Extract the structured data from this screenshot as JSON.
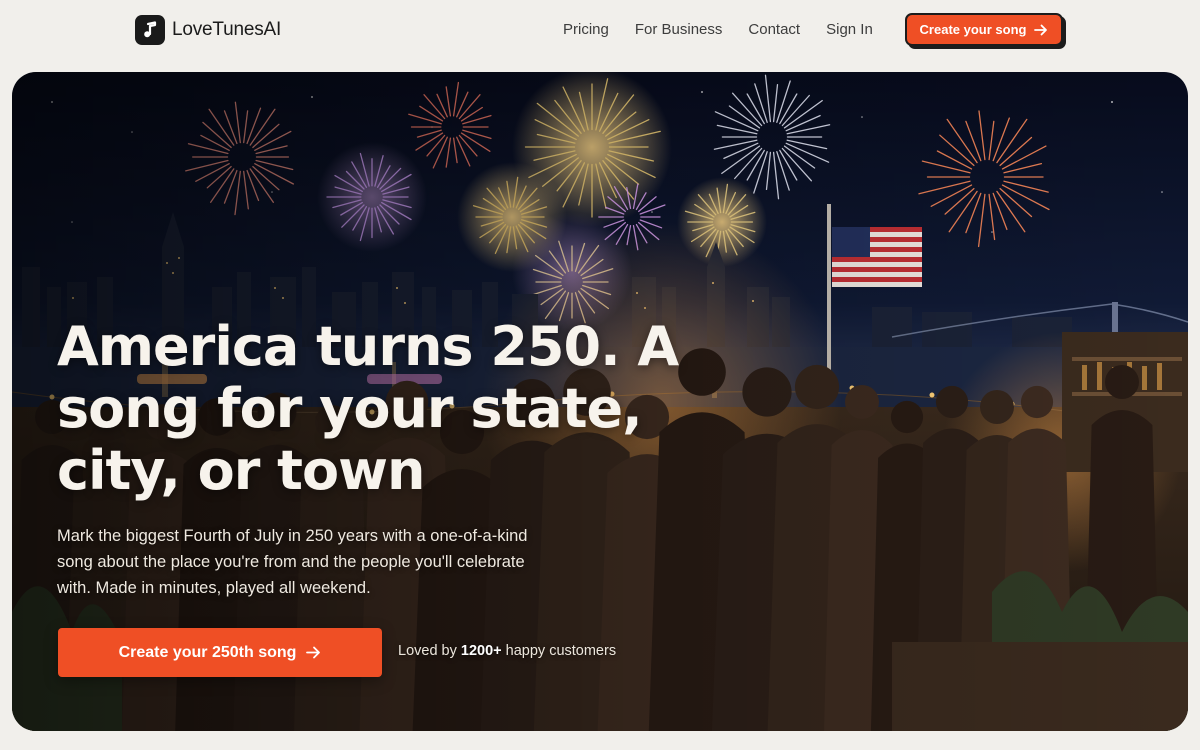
{
  "header": {
    "brand_name": "LoveTunesAI",
    "nav": [
      {
        "label": "Pricing"
      },
      {
        "label": "For Business"
      },
      {
        "label": "Contact"
      },
      {
        "label": "Sign In"
      }
    ],
    "cta_label": "Create your song"
  },
  "hero": {
    "title": "America turns 250. A song for your state, city, or town",
    "subtitle": "Mark the biggest Fourth of July in 250 years with a one-of-a-kind song about the place you're from and the people you'll celebrate with. Made in minutes, played all weekend.",
    "cta_label": "Create your 250th song",
    "social_proof": {
      "prefix": "Loved by",
      "count": "1200+",
      "suffix": "happy customers"
    }
  },
  "colors": {
    "accent": "#ef4f25",
    "page_background": "#f1efeb",
    "night_sky": "#0c1326"
  },
  "icons": {
    "brand": "music-note-icon",
    "cta": "arrow-right-icon"
  }
}
